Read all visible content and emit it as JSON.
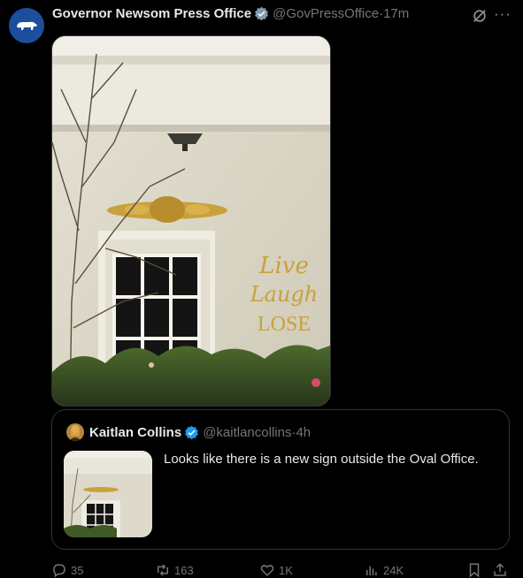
{
  "post": {
    "author_name": "Governor Newsom Press Office",
    "author_handle": "@GovPressOffice",
    "separator": " · ",
    "time": "17m",
    "more": "···"
  },
  "photo": {
    "sign_line1": "Live",
    "sign_line2": "Laugh",
    "sign_line3": "LOSE"
  },
  "quote": {
    "author_name": "Kaitlan Collins",
    "author_handle": "@kaitlancollins",
    "separator": " · ",
    "time": "4h",
    "text": "Looks like there is a new sign outside the Oval Office."
  },
  "actions": {
    "replies": "35",
    "reposts": "163",
    "likes": "1K",
    "views": "24K"
  },
  "colors": {
    "accent": "#1d9bf0",
    "muted": "#71767b",
    "gold": "#c9a13b"
  }
}
